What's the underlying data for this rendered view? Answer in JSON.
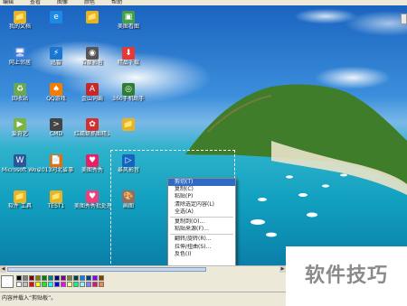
{
  "menubar": {
    "items": [
      "编辑",
      "查看",
      "图像",
      "颜色",
      "帮助"
    ]
  },
  "desktop": {
    "icons": [
      {
        "label": "我的文档",
        "glyph": "📁",
        "color": "#e6b422"
      },
      {
        "label": "网上邻居",
        "glyph": "🖥",
        "color": "#3a7bd5"
      },
      {
        "label": "回收站",
        "glyph": "♻",
        "color": "#6aa84f"
      },
      {
        "label": "爱奇艺",
        "glyph": "▶",
        "color": "#7cb342"
      },
      {
        "label": "Microsoft Word 2003",
        "glyph": "W",
        "color": "#2b579a"
      },
      {
        "label": "软件 工具",
        "glyph": "📁",
        "color": "#e6b422"
      },
      {
        "label": "",
        "glyph": "e",
        "color": "#1e88e5"
      },
      {
        "label": "迅雷",
        "glyph": "⚡",
        "color": "#1976d2"
      },
      {
        "label": "QQ游戏",
        "glyph": "♠",
        "color": "#f57c00"
      },
      {
        "label": "CMD",
        "glyph": ">",
        "color": "#444444"
      },
      {
        "label": "2013河北省事业单位...",
        "glyph": "📄",
        "color": "#ef6c00"
      },
      {
        "label": "TEST1",
        "glyph": "📁",
        "color": "#e6b422"
      },
      {
        "label": "",
        "glyph": "📁",
        "color": "#e6b422"
      },
      {
        "label": "百度影音",
        "glyph": "◉",
        "color": "#555555"
      },
      {
        "label": "金山词霸",
        "glyph": "A",
        "color": "#c62828"
      },
      {
        "label": "红蜻蜓抓图精灵",
        "glyph": "✿",
        "color": "#d32f2f"
      },
      {
        "label": "美图秀秀",
        "glyph": "♥",
        "color": "#e91e63"
      },
      {
        "label": "美图秀秀批处理",
        "glyph": "♥",
        "color": "#ec407a"
      },
      {
        "label": "美图看图",
        "glyph": "▣",
        "color": "#43a047"
      },
      {
        "label": "精品下载",
        "glyph": "⬇",
        "color": "#e53935"
      },
      {
        "label": "360手机助手",
        "glyph": "◎",
        "color": "#2e7d32"
      },
      {
        "label": "",
        "glyph": "📁",
        "color": "#e6b422"
      },
      {
        "label": "暴风影音",
        "glyph": "▷",
        "color": "#1565c0"
      },
      {
        "label": "画图",
        "glyph": "🎨",
        "color": "#8d6e63"
      }
    ]
  },
  "context_menu": {
    "items": [
      "剪切(T)",
      "复制(C)",
      "粘贴(P)",
      "清除选定内容(L)",
      "全选(A)",
      "复制到(O)...",
      "粘贴来源(F)...",
      "翻转/旋转(R)...",
      "拉伸/扭曲(S)...",
      "反色(I)"
    ],
    "highlighted": 0,
    "separators_after": [
      4,
      6
    ]
  },
  "palette": [
    "#000000",
    "#808080",
    "#800000",
    "#808000",
    "#008000",
    "#008080",
    "#000080",
    "#800080",
    "#808040",
    "#004040",
    "#0080ff",
    "#004080",
    "#8000ff",
    "#804000",
    "#ffffff",
    "#c0c0c0",
    "#ff0000",
    "#ffff00",
    "#00ff00",
    "#00ffff",
    "#0000ff",
    "#ff00ff",
    "#ffff80",
    "#00ff80",
    "#80ffff",
    "#8080ff",
    "#ff0080",
    "#ff8040"
  ],
  "status": {
    "text": "内容并载入“剪贴板”。"
  },
  "watermark": {
    "text": "软件技巧"
  },
  "colors": {
    "menu_highlight": "#316ac5",
    "chrome": "#ece9d8"
  }
}
